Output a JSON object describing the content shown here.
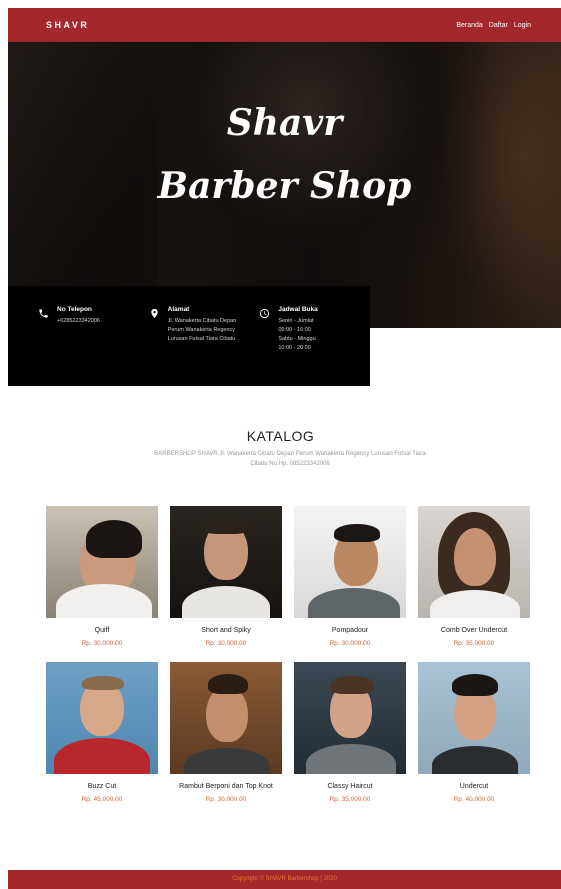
{
  "navbar": {
    "brand": "SHAVR",
    "links": [
      "Beranda",
      "Daftar",
      "Login"
    ]
  },
  "hero": {
    "title_line1": "Shavr",
    "title_line2": "Barber Shop"
  },
  "info": {
    "phone": {
      "title": "No Telepon",
      "lines": [
        "+6285223342006"
      ]
    },
    "address": {
      "title": "Alamat",
      "lines": [
        "Jl. Wanakerta Cibatu Depan",
        "Perum Wanakerta Regency",
        "Lurusan Futsal Tiara Cibatu"
      ]
    },
    "schedule": {
      "title": "Jadwal Buka",
      "lines": [
        "Senin - Jumlat",
        "09:00 - 16:00",
        "Sabtu - Minggu",
        "10:00 - 20:00"
      ]
    }
  },
  "catalog": {
    "title": "KATALOG",
    "description": "BARBERSHOP SHAVR Jl. Wanakerta Cibatu Depan Perum Wanakerta Regency Lurusan Futsal Tiara Cibatu No.Hp. 085223342006",
    "items": [
      {
        "name": "Quiff",
        "price": "Rp. 30,000.00"
      },
      {
        "name": "Short and Spiky",
        "price": "Rp. 30,000.00"
      },
      {
        "name": "Pompadour",
        "price": "Rp. 30,000.00"
      },
      {
        "name": "Comb Over Undercut",
        "price": "Rp. 35,000.00"
      },
      {
        "name": "Buzz Cut",
        "price": "Rp. 45,000.00"
      },
      {
        "name": "Rambut Berponi dan Top Knot",
        "price": "Rp. 30,000.00"
      },
      {
        "name": "Classy Haircut",
        "price": "Rp. 35,000.00"
      },
      {
        "name": "Undercut",
        "price": "Rp. 40,000.00"
      }
    ]
  },
  "footer": {
    "text": "Copyright © SHAVR Barbershop | 2020"
  },
  "colors": {
    "brand_red": "#a3272b",
    "price_orange": "#d2643a"
  }
}
